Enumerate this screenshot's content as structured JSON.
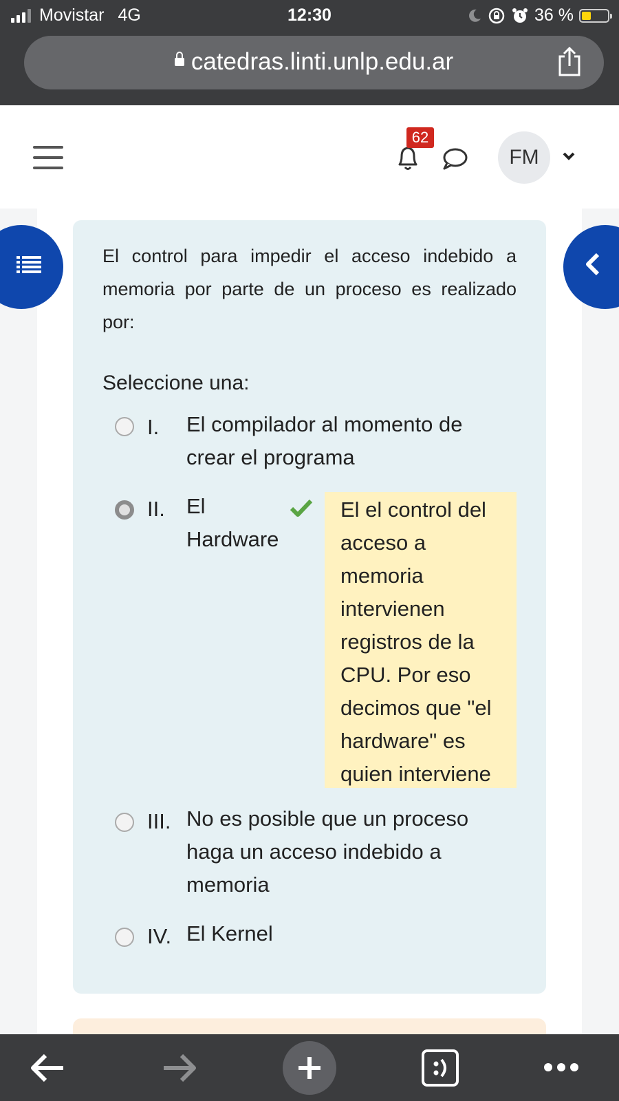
{
  "status_bar": {
    "carrier": "Movistar",
    "network": "4G",
    "time": "12:30",
    "battery_text": "36 %",
    "battery_level": 0.36
  },
  "browser": {
    "url": "catedras.linti.unlp.edu.ar"
  },
  "header": {
    "notification_count": "62",
    "avatar_initials": "FM"
  },
  "question": {
    "text": "El control para impedir el acceso indebido a memoria por parte de un proceso es realizado por:",
    "select_prompt": "Seleccione una:",
    "options": [
      {
        "number": "I.",
        "label_lines": [
          "El compilador al momento de",
          "crear el programa"
        ],
        "selected": false
      },
      {
        "number": "II.",
        "label_lines": [
          "El",
          "Hardware"
        ],
        "selected": true,
        "correct": true
      },
      {
        "number": "III.",
        "label_lines": [
          "No es posible que un proceso",
          "haga un acceso indebido a",
          "memoria"
        ],
        "selected": false
      },
      {
        "number": "IV.",
        "label_lines": [
          "El Kernel"
        ],
        "selected": false
      }
    ],
    "feedback_lines": [
      "El el control del",
      "acceso a",
      "memoria",
      "intervienen",
      "registros de la",
      "CPU. Por eso",
      "decimos que \"el",
      "hardware\" es",
      "quien interviene"
    ]
  },
  "colors": {
    "brand_blue": "#0f47ad",
    "card_bg": "#e6f1f4",
    "feedback_bg": "#fff2c0",
    "correct_green": "#5aa544",
    "badge_red": "#d0281f"
  }
}
